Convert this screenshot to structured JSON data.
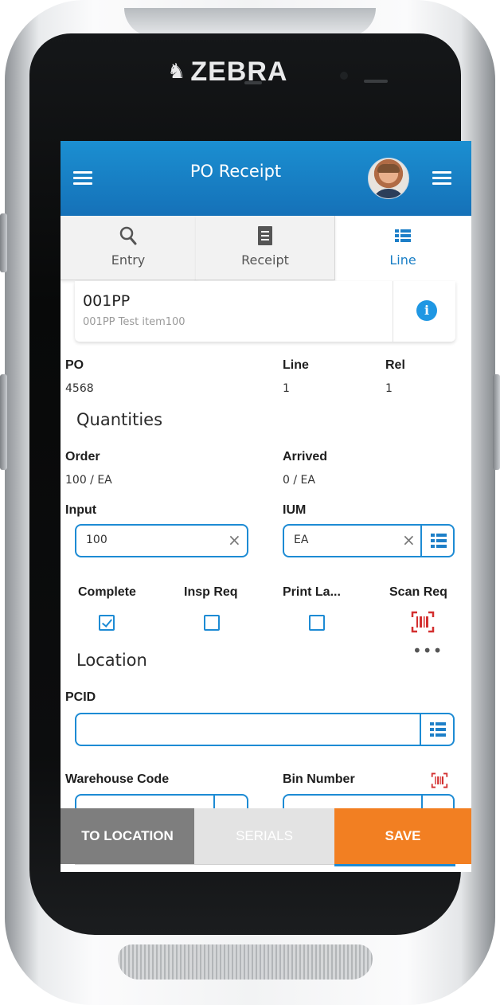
{
  "device": {
    "brand": "ZEBRA"
  },
  "header": {
    "title": "PO Receipt"
  },
  "tabs": [
    {
      "label": "Entry",
      "icon": "search-icon"
    },
    {
      "label": "Receipt",
      "icon": "receipt-icon"
    },
    {
      "label": "Line",
      "icon": "list-icon",
      "active": true
    }
  ],
  "item": {
    "code": "001PP",
    "description": "001PP Test item100"
  },
  "po": {
    "po_label": "PO",
    "po_value": "4568",
    "line_label": "Line",
    "line_value": "1",
    "rel_label": "Rel",
    "rel_value": "1"
  },
  "quantities": {
    "section_title": "Quantities",
    "order_label": "Order",
    "order_value": "100 / EA",
    "arrived_label": "Arrived",
    "arrived_value": "0 / EA",
    "input_label": "Input",
    "input_value": "100",
    "ium_label": "IUM",
    "ium_value": "EA"
  },
  "flags": {
    "complete_label": "Complete",
    "complete_checked": true,
    "insp_req_label": "Insp Req",
    "insp_req_checked": false,
    "print_label": "Print La...",
    "print_checked": false,
    "scan_req_label": "Scan Req"
  },
  "location": {
    "section_title": "Location",
    "pcid_label": "PCID",
    "pcid_value": "",
    "warehouse_label": "Warehouse Code",
    "bin_label": "Bin Number"
  },
  "actions": {
    "to_location": "TO LOCATION",
    "serials": "SERIALS",
    "save": "SAVE"
  },
  "colors": {
    "header": "#1a7fc6",
    "accent": "#1d8bd4",
    "save": "#f27f22",
    "to_location": "#7e7e7e",
    "barcode": "#d32f2f"
  }
}
